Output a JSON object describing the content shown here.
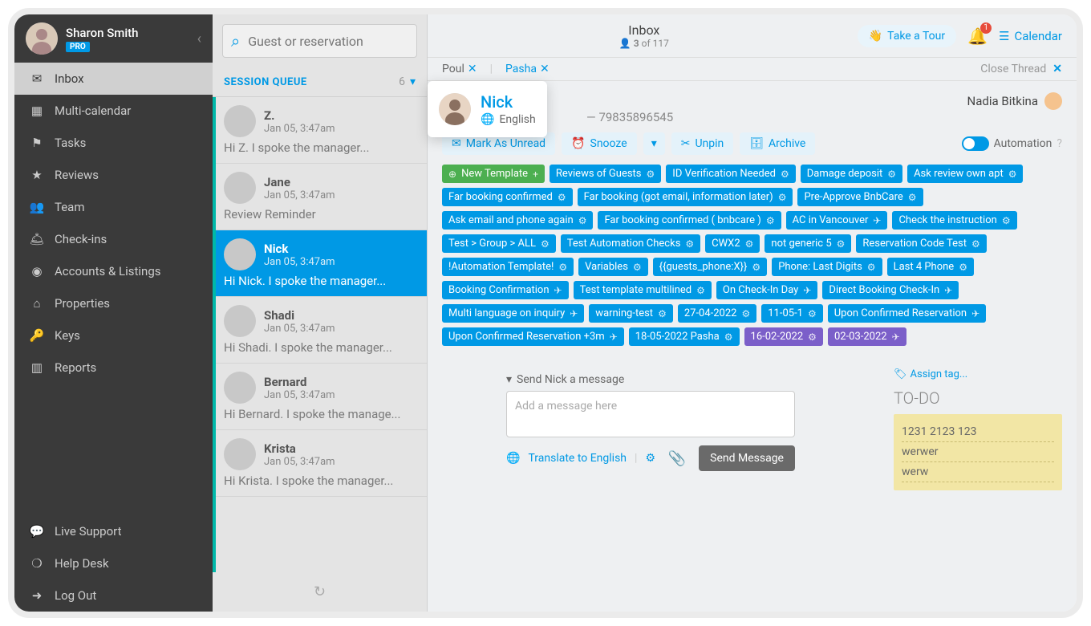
{
  "user": {
    "name": "Sharon Smith",
    "badge": "PRO"
  },
  "nav": {
    "inbox": "Inbox",
    "multical": "Multi-calendar",
    "tasks": "Tasks",
    "reviews": "Reviews",
    "team": "Team",
    "checkins": "Check-ins",
    "accounts": "Accounts & Listings",
    "properties": "Properties",
    "keys": "Keys",
    "reports": "Reports",
    "live": "Live Support",
    "help": "Help Desk",
    "logout": "Log Out"
  },
  "search": {
    "placeholder": "Guest or reservation"
  },
  "queue": {
    "title": "SESSION QUEUE",
    "count": "6"
  },
  "queueItems": [
    {
      "name": "Z.",
      "date": "Jan 05, 3:47am",
      "preview": "Hi Z. I spoke the manager..."
    },
    {
      "name": "Jane",
      "date": "Jan 05, 3:47am",
      "preview": "Review Reminder"
    },
    {
      "name": "Nick",
      "date": "Jan 05, 3:47am",
      "preview": "Hi Nick. I spoke the manager..."
    },
    {
      "name": "Shadi",
      "date": "Jan 05, 3:47am",
      "preview": "Hi Shadi. I spoke the manager..."
    },
    {
      "name": "Bernard",
      "date": "Jan 05, 3:47am",
      "preview": "Hi Bernard. I spoke the manage..."
    },
    {
      "name": "Krista",
      "date": "Jan 05, 3:47am",
      "preview": "Hi Krista. I spoke the manager..."
    }
  ],
  "top": {
    "title": "Inbox",
    "pos": "3",
    "total": "of 117",
    "tour": "Take a Tour",
    "bell": "1",
    "calendar": "Calendar"
  },
  "tabs": {
    "t1": "Poul",
    "t2": "Pasha",
    "close": "Close Thread"
  },
  "popup": {
    "name": "Nick",
    "language": "English"
  },
  "phone": "79835896545",
  "nadia": "Nadia Bitkina",
  "actions": {
    "unread": "Mark As Unread",
    "snooze": "Snooze",
    "unpin": "Unpin",
    "archive": "Archive",
    "automation": "Automation"
  },
  "tags": [
    {
      "t": "New Template",
      "cls": "green",
      "ic": "plus"
    },
    {
      "t": "Reviews of Guests",
      "ic": "gear"
    },
    {
      "t": "ID Verification Needed",
      "ic": "gear"
    },
    {
      "t": "Damage deposit",
      "ic": "gear"
    },
    {
      "t": "Ask review own apt",
      "ic": "gear"
    },
    {
      "t": "Far booking confirmed",
      "ic": "gear"
    },
    {
      "t": "Far booking (got email, information later)",
      "ic": "gear"
    },
    {
      "t": "Pre-Approve BnbCare",
      "ic": "gear"
    },
    {
      "t": "Ask email and phone again",
      "ic": "gear"
    },
    {
      "t": "Far booking confirmed ( bnbcare )",
      "ic": "gear"
    },
    {
      "t": "AC in Vancouver",
      "ic": "plane"
    },
    {
      "t": "Check the instruction",
      "ic": "gear"
    },
    {
      "t": "Test > Group > ALL",
      "ic": "gear"
    },
    {
      "t": "Test Automation Checks",
      "ic": "gear"
    },
    {
      "t": "CWX2",
      "ic": "gear"
    },
    {
      "t": "not generic 5",
      "ic": "gear"
    },
    {
      "t": "Reservation Code Test",
      "ic": "gear"
    },
    {
      "t": "!Automation Template!",
      "ic": "gear"
    },
    {
      "t": "Variables",
      "ic": "gear"
    },
    {
      "t": "{{guests_phone:X}}",
      "ic": "gear"
    },
    {
      "t": "Phone: Last Digits",
      "ic": "gear"
    },
    {
      "t": "Last 4 Phone",
      "ic": "gear"
    },
    {
      "t": "Booking Confirmation",
      "ic": "plane"
    },
    {
      "t": "Test template multilined",
      "ic": "gear"
    },
    {
      "t": "On Check-In Day",
      "ic": "plane"
    },
    {
      "t": "Direct Booking Check-In",
      "ic": "plane"
    },
    {
      "t": "Multi language on inquiry",
      "ic": "plane"
    },
    {
      "t": "warning-test",
      "ic": "gear"
    },
    {
      "t": "27-04-2022",
      "ic": "gear"
    },
    {
      "t": "11-05-1",
      "ic": "gear"
    },
    {
      "t": "Upon Confirmed Reservation",
      "ic": "plane"
    },
    {
      "t": "Upon Confirmed Reservation +3m",
      "ic": "plane"
    },
    {
      "t": "18-05-2022 Pasha",
      "ic": "gear"
    },
    {
      "t": "16-02-2022",
      "cls": "purple",
      "ic": "gear"
    },
    {
      "t": "02-03-2022",
      "cls": "purple",
      "ic": "plane"
    }
  ],
  "composer": {
    "head": "Send Nick a message",
    "placeholder": "Add a message here",
    "translate": "Translate to English",
    "send": "Send Message"
  },
  "right": {
    "assign": "Assign tag...",
    "todo": "TO-DO",
    "notes": [
      "1231 2123 123",
      "werwer",
      "werw"
    ]
  }
}
